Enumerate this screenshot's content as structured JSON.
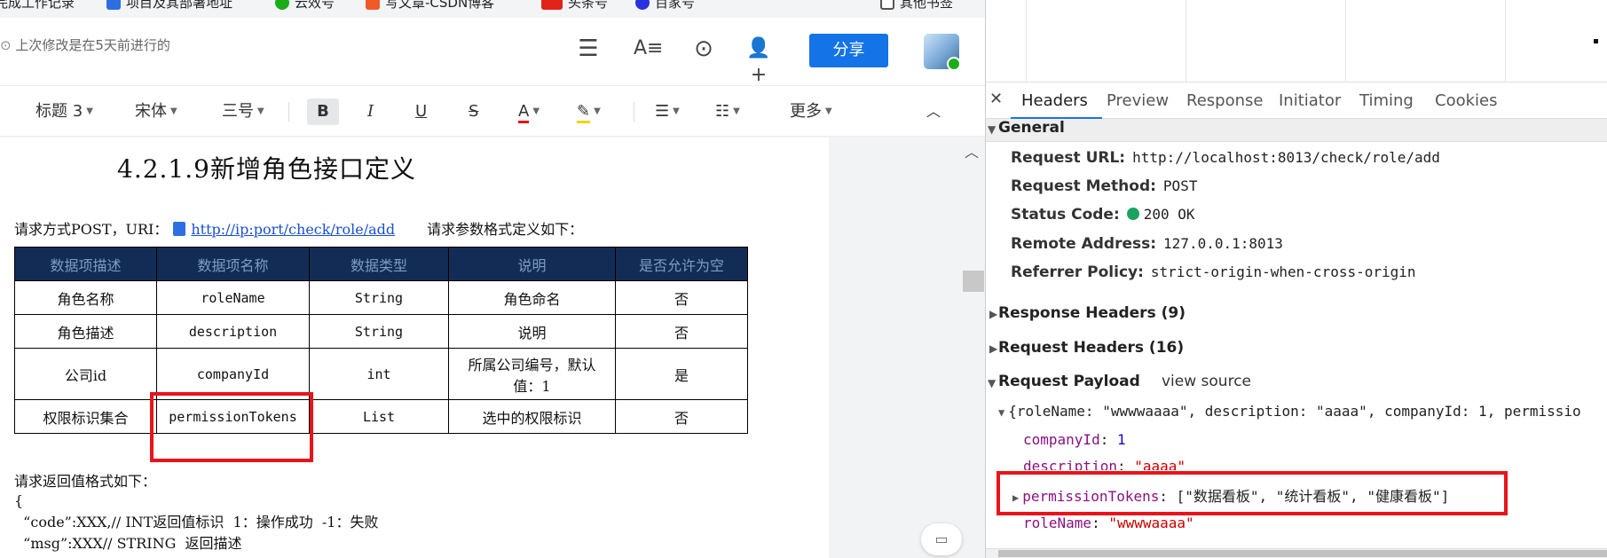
{
  "bookmarks": [
    {
      "label": "完成工作记录",
      "icon": "bookmark-icon"
    },
    {
      "label": "项目及其部署地址",
      "icon": "blue-doc-icon"
    },
    {
      "label": "云效号",
      "icon": "green-chat-icon"
    },
    {
      "label": "写文章-CSDN博客",
      "icon": "csdn-icon"
    },
    {
      "label": "头条号",
      "icon": "toutiao-icon"
    },
    {
      "label": "百家号",
      "icon": "baijiahao-icon"
    },
    {
      "label": "其他书签",
      "icon": "folder-icon"
    }
  ],
  "editor": {
    "last_modified": "上次修改是在5天前进行的",
    "share_label": "分享",
    "toolbar": {
      "heading": "标题 3",
      "font": "宋体",
      "size": "三号",
      "bold": "B",
      "italic": "I",
      "underline": "U",
      "strike": "S",
      "font_color": "A",
      "more": "更多"
    }
  },
  "doc": {
    "heading": "4.2.1.9新增角色接口定义",
    "request_prefix": "请求方式POST，URI：",
    "request_link": "http://ip:port/check/role/add",
    "request_suffix": "请求参数格式定义如下：",
    "table": {
      "headers": [
        "数据项描述",
        "数据项名称",
        "数据类型",
        "说明",
        "是否允许为空"
      ],
      "rows": [
        [
          "角色名称",
          "roleName",
          "String",
          "角色命名",
          "否"
        ],
        [
          "角色描述",
          "description",
          "String",
          "说明",
          "否"
        ],
        [
          "公司id",
          "companyId",
          "int",
          "所属公司编号，默认值：1",
          "是"
        ],
        [
          "权限标识集合",
          "permissionTokens",
          "List",
          "选中的权限标识",
          "否"
        ]
      ]
    },
    "return_title": "请求返回值格式如下：",
    "code_lines": [
      "{",
      "  “code”:XXX,// INT返回值标识  1：操作成功  -1：失败",
      "  “msg”:XXX// STRING  返回描述"
    ]
  },
  "devtools": {
    "tabs": [
      "Headers",
      "Preview",
      "Response",
      "Initiator",
      "Timing",
      "Cookies"
    ],
    "active_tab": "Headers",
    "general_title": "General",
    "general": [
      {
        "key": "Request URL:",
        "value": "http://localhost:8013/check/role/add"
      },
      {
        "key": "Request Method:",
        "value": "POST"
      },
      {
        "key": "Status Code:",
        "value": "200 OK"
      },
      {
        "key": "Remote Address:",
        "value": "127.0.0.1:8013"
      },
      {
        "key": "Referrer Policy:",
        "value": "strict-origin-when-cross-origin"
      }
    ],
    "response_headers": "Response Headers (9)",
    "request_headers": "Request Headers (16)",
    "request_payload": "Request Payload",
    "view_source": "view source",
    "payload_summary": "{roleName: \"wwwwaaaa\", description: \"aaaa\", companyId: 1, permissio",
    "payload_fields": [
      {
        "key": "companyId",
        "value": "1",
        "type": "number"
      },
      {
        "key": "description",
        "value": "\"aaaa\"",
        "type": "string"
      },
      {
        "key": "permissionTokens",
        "value": "[\"数据看板\", \"统计看板\", \"健康看板\"]",
        "type": "object"
      },
      {
        "key": "roleName",
        "value": "\"wwwwaaaa\"",
        "type": "string"
      }
    ]
  },
  "colors": {
    "share_blue": "#1473e6",
    "table_header_bg": "#132c55",
    "highlight_red": "#e8141a",
    "devtools_accent": "#1a73e8"
  }
}
